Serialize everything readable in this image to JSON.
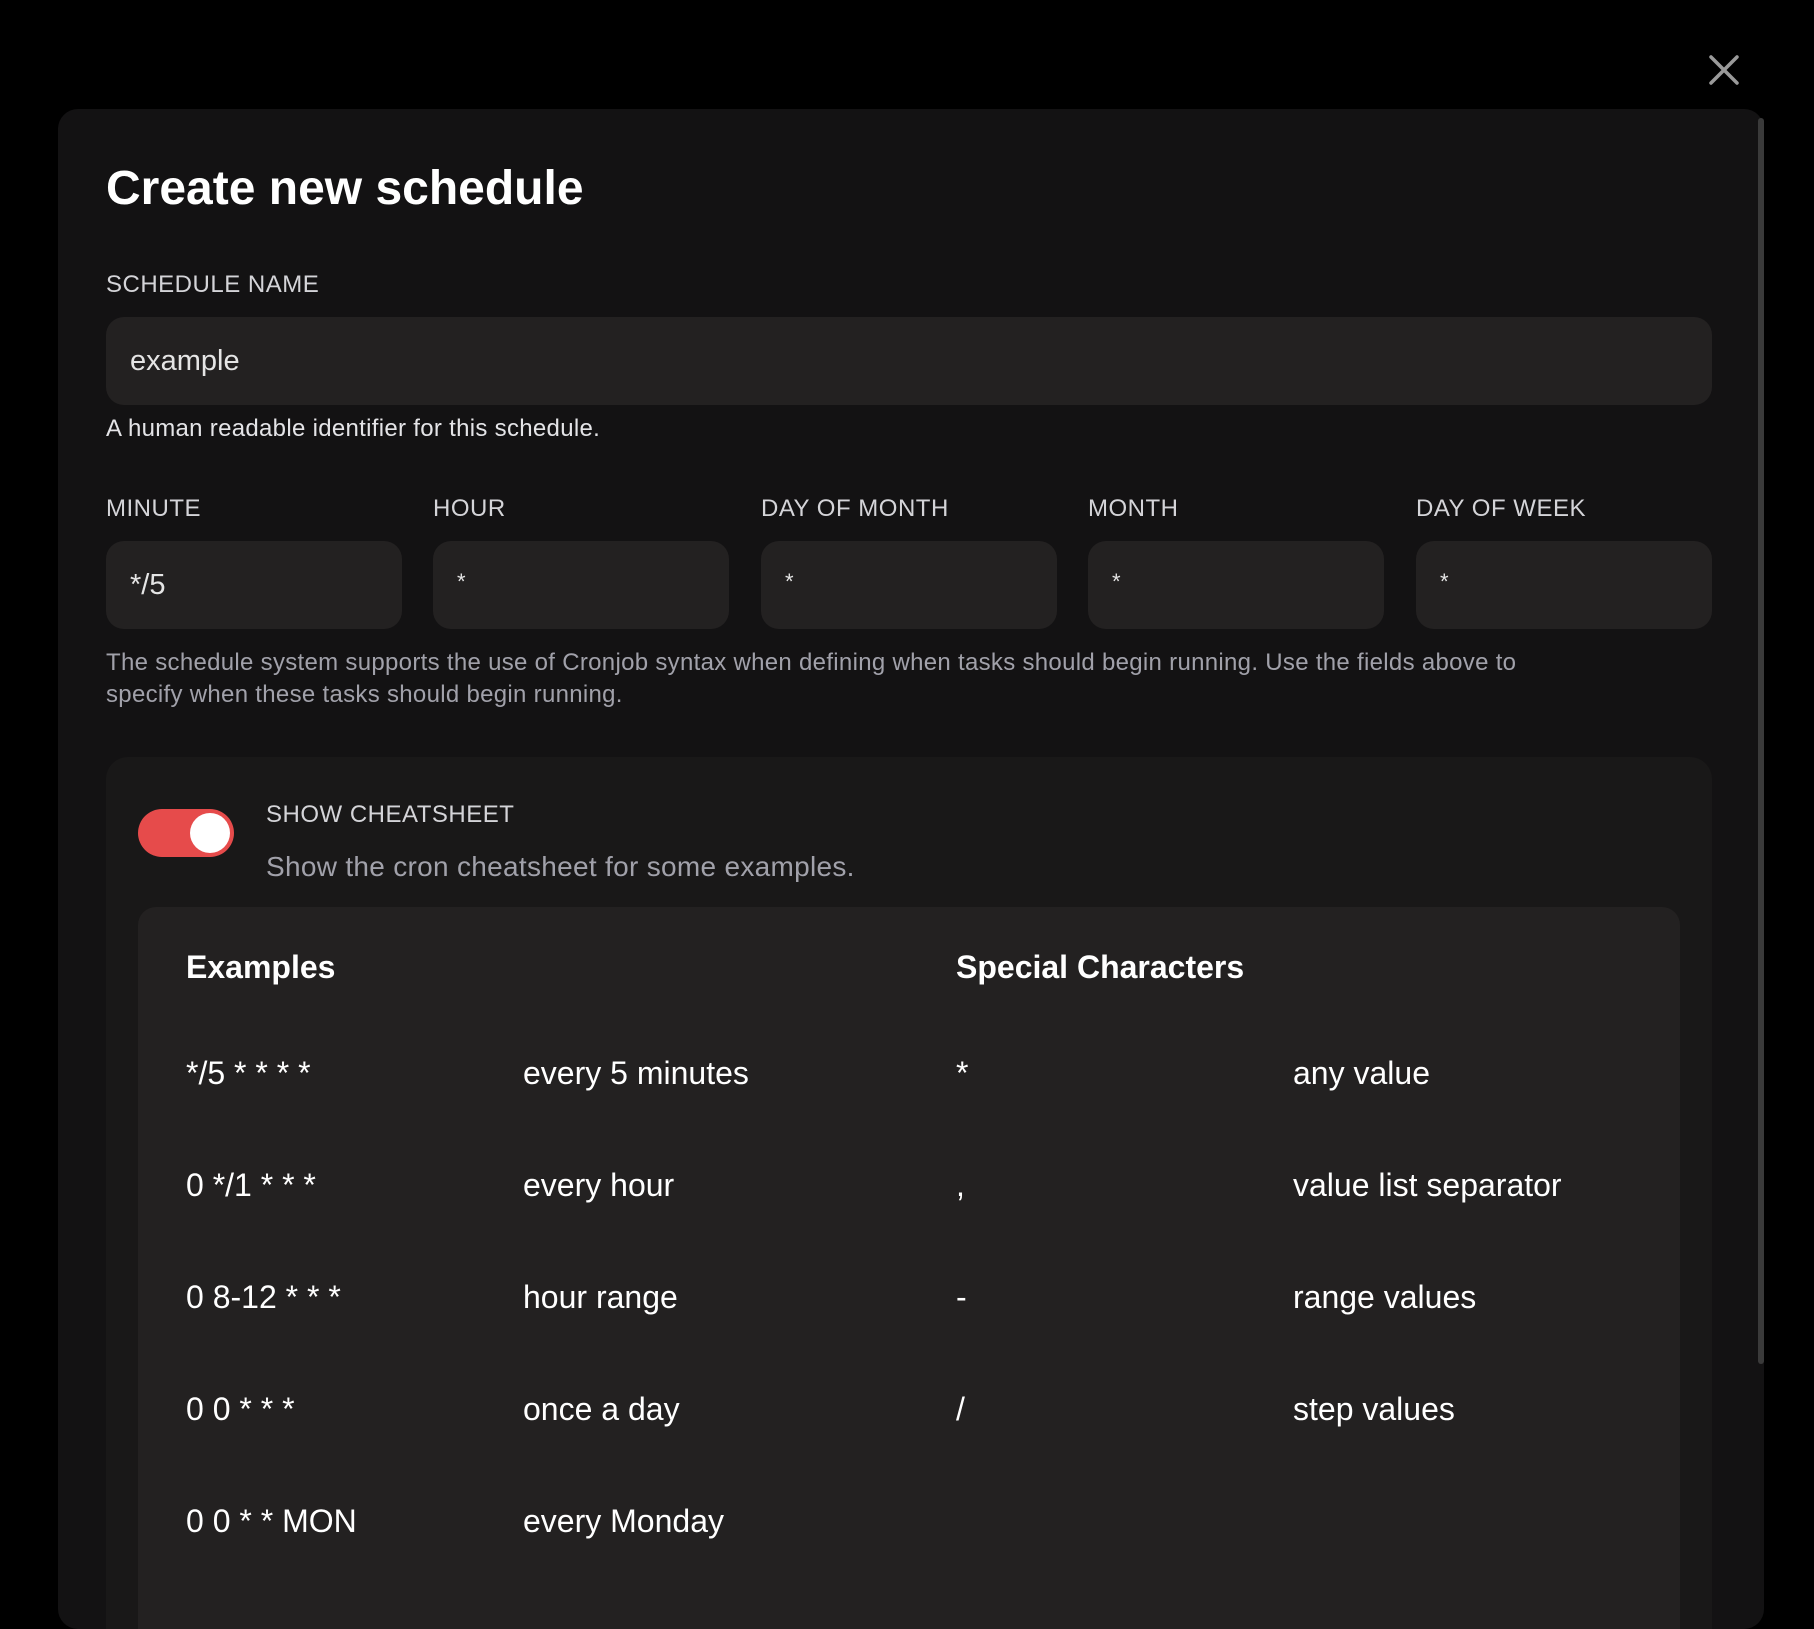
{
  "close_icon": "close-icon",
  "modal": {
    "title": "Create new schedule",
    "schedule_name": {
      "label": "SCHEDULE NAME",
      "value": "example",
      "help": "A human readable identifier for this schedule."
    },
    "cron_fields": [
      {
        "label": "MINUTE",
        "value": "*/5"
      },
      {
        "label": "HOUR",
        "value": "*"
      },
      {
        "label": "DAY OF MONTH",
        "value": "*"
      },
      {
        "label": "MONTH",
        "value": "*"
      },
      {
        "label": "DAY OF WEEK",
        "value": "*"
      }
    ],
    "cron_help_line1": "The schedule system supports the use of Cronjob syntax when defining when tasks should begin running. Use the fields above to",
    "cron_help_line2": "specify when these tasks should begin running.",
    "cheatsheet": {
      "toggle_on": true,
      "toggle_color": "#e64b4b",
      "title": "SHOW CHEATSHEET",
      "description": "Show the cron cheatsheet for some examples.",
      "examples_heading": "Examples",
      "special_heading": "Special Characters",
      "examples": [
        {
          "expr": "*/5 * * * *",
          "desc": "every 5 minutes"
        },
        {
          "expr": "0 */1 * * *",
          "desc": "every hour"
        },
        {
          "expr": "0 8-12 * * *",
          "desc": "hour range"
        },
        {
          "expr": "0 0 * * *",
          "desc": "once a day"
        },
        {
          "expr": "0 0 * * MON",
          "desc": "every Monday"
        }
      ],
      "special": [
        {
          "char": "*",
          "desc": "any value"
        },
        {
          "char": ",",
          "desc": "value list separator"
        },
        {
          "char": "-",
          "desc": "range values"
        },
        {
          "char": "/",
          "desc": "step values"
        }
      ]
    }
  }
}
